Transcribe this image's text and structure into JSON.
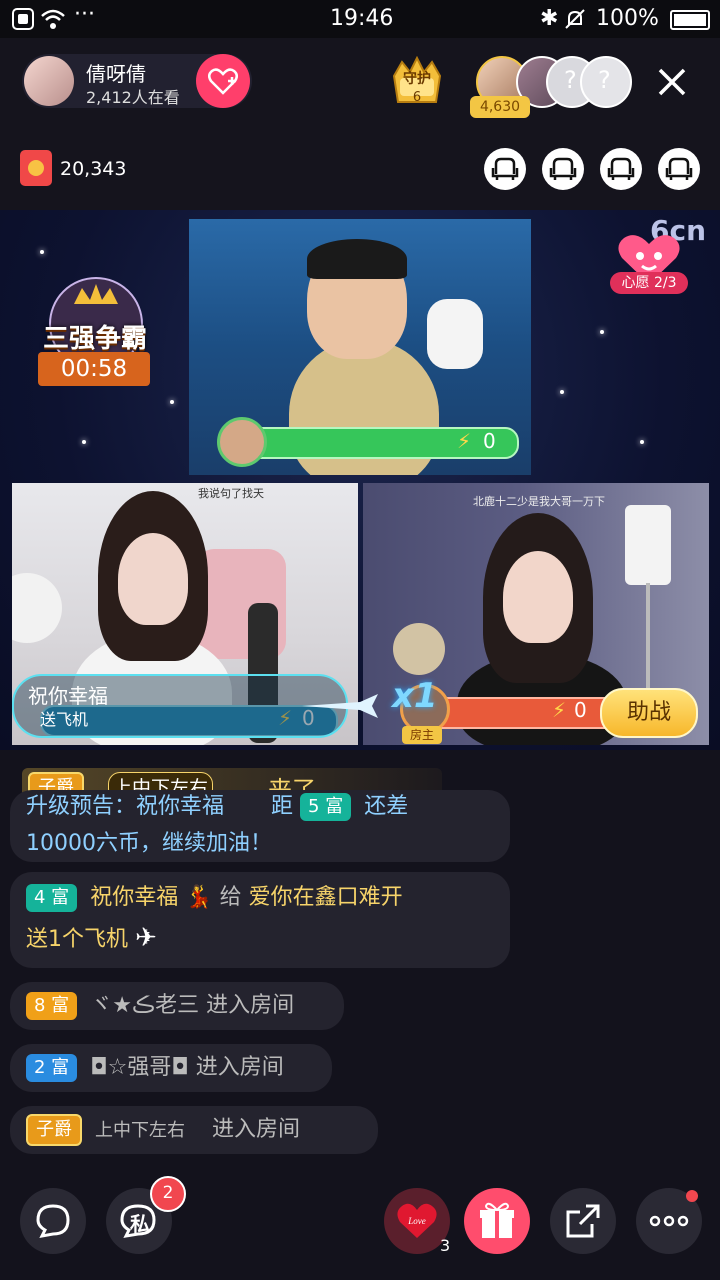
{
  "status_bar": {
    "time": "19:46",
    "battery": "100%"
  },
  "host": {
    "name": "倩呀倩",
    "viewers": "2,412人在看"
  },
  "guard": {
    "label": "守护",
    "count": "6"
  },
  "top_fans": {
    "coins": "4,630"
  },
  "red_packet": {
    "count": "20,343"
  },
  "pk": {
    "title": "三强争霸",
    "timer": "00:58"
  },
  "logo": "6cn",
  "wish": {
    "label": "心愿",
    "progress": "2/3"
  },
  "main_video": {
    "score": "0"
  },
  "left_video": {
    "score": "0",
    "gift_name": "祝你幸福",
    "gift_sub": "送飞机",
    "caption": "我说句了找天"
  },
  "right_video": {
    "score": "0",
    "caption": "北鹿十二少是我大哥一万下",
    "host_label": "房主",
    "combo": "x1"
  },
  "assist_button": "助战",
  "chat": {
    "announce": {
      "tag": "子爵",
      "user": "上中下左右",
      "action": "来了"
    },
    "msg1": {
      "text_a": "升级预告：祝你幸福",
      "text_b": "距",
      "tag": "5 富",
      "text_c": "还差",
      "line2": "10000六币，继续加油！"
    },
    "msg2": {
      "tag": "4 富",
      "user": "祝你幸福",
      "verb": "给",
      "target": "爱你在鑫口难开",
      "line2": "送1个飞机"
    },
    "msg3": {
      "tag": "8 富",
      "user": "ヾ★ڪ老三",
      "action": "进入房间"
    },
    "msg4": {
      "tag": "2 富",
      "user": "◘☆强哥◘",
      "action": "进入房间"
    },
    "msg5": {
      "tag": "子爵",
      "user": "上中下左右",
      "action": "进入房间"
    }
  },
  "bottom": {
    "private_label": "私",
    "private_badge": "2",
    "love_count": "3",
    "love_label": "Love"
  },
  "colors": {
    "accent": "#ff3f6b",
    "gold": "#f7d46a",
    "green_bar": "#36c65a",
    "blue_bar": "#1c8fc0",
    "red_bar": "#e85a3a"
  }
}
